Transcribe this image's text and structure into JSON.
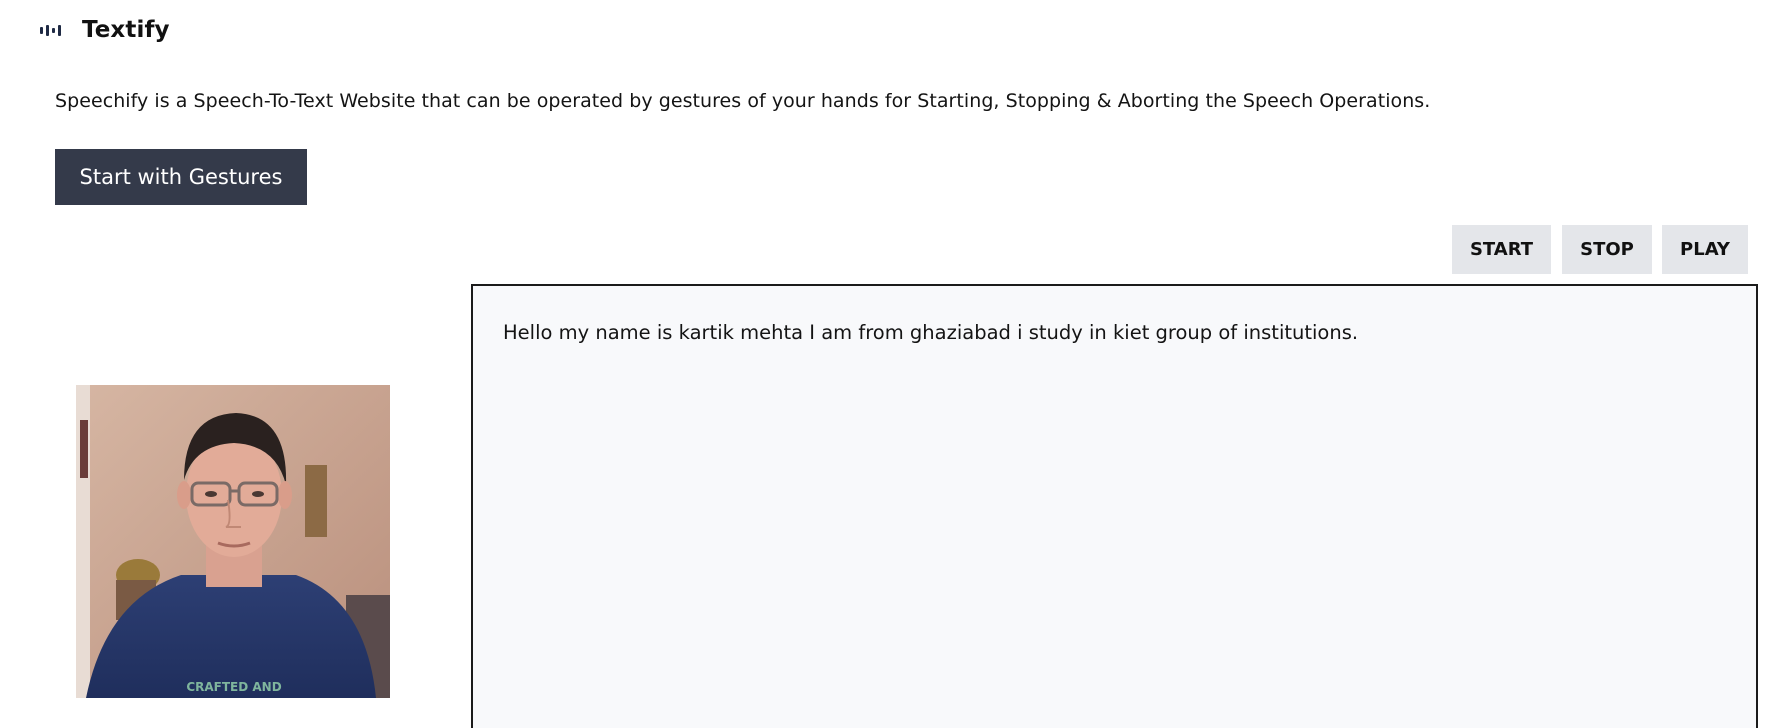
{
  "header": {
    "icon": "audio-wave-icon",
    "brand_name": "Textify"
  },
  "intro": {
    "description": "Speechify is a Speech-To-Text Website that can be operated by gestures of your hands for Starting, Stopping & Aborting the Speech Operations."
  },
  "actions": {
    "gesture_button_label": "Start with Gestures"
  },
  "controls": {
    "start_label": "START",
    "stop_label": "STOP",
    "play_label": "PLAY"
  },
  "transcript": {
    "text": "Hello my name is kartik mehta I am from ghaziabad i study in kiet group of institutions."
  },
  "camera": {
    "shirt_text": "CRAFTED AND"
  },
  "colors": {
    "brand_icon": "#1f2a44",
    "primary_button": "#343a4a",
    "control_button": "#e4e6ea",
    "transcript_bg": "#f8f9fb"
  }
}
